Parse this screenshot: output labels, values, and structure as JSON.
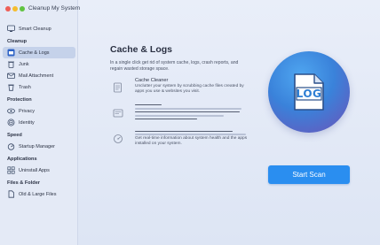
{
  "app": {
    "title": "Cleanup My System"
  },
  "sidebar": {
    "top_item": {
      "label": "Smart Cleanup",
      "icon": "monitor-icon"
    },
    "sections": [
      {
        "heading": "Cleanup",
        "items": [
          {
            "label": "Cache & Logs",
            "icon": "cache-logs-icon",
            "active": true
          },
          {
            "label": "Junk",
            "icon": "trash-can-icon"
          },
          {
            "label": "Mail Attachment",
            "icon": "mail-icon"
          },
          {
            "label": "Trash",
            "icon": "trash-icon"
          }
        ]
      },
      {
        "heading": "Protection",
        "items": [
          {
            "label": "Privacy",
            "icon": "privacy-icon"
          },
          {
            "label": "Identity",
            "icon": "fingerprint-icon"
          }
        ]
      },
      {
        "heading": "Speed",
        "items": [
          {
            "label": "Startup Manager",
            "icon": "startup-icon"
          }
        ]
      },
      {
        "heading": "Applications",
        "items": [
          {
            "label": "Uninstall Apps",
            "icon": "uninstall-icon"
          }
        ]
      },
      {
        "heading": "Files & Folder",
        "items": [
          {
            "label": "Old & Large Files",
            "icon": "files-icon"
          }
        ]
      }
    ]
  },
  "main": {
    "title": "Cache & Logs",
    "subtitle": "In a single click get rid of system cache, logs, crash reports, and regain wasted storage space.",
    "features": [
      {
        "title": "Cache Cleaner",
        "description": "Unclutter your system by scrubbing cache files created by apps you use & websites you visit.",
        "icon": "cache-cleaner-icon"
      },
      {
        "title": "",
        "description": "",
        "icon": "log-cleaner-icon"
      },
      {
        "title": "",
        "description": "Get real-time information about system health and the apps installed on your system.",
        "icon": "system-info-icon"
      }
    ],
    "logo_text": "LOG",
    "scan_button": "Start Scan"
  },
  "colors": {
    "accent": "#2a8ef0",
    "active_item": "#c5d2ea",
    "sidebar": "#e4eaf6"
  }
}
